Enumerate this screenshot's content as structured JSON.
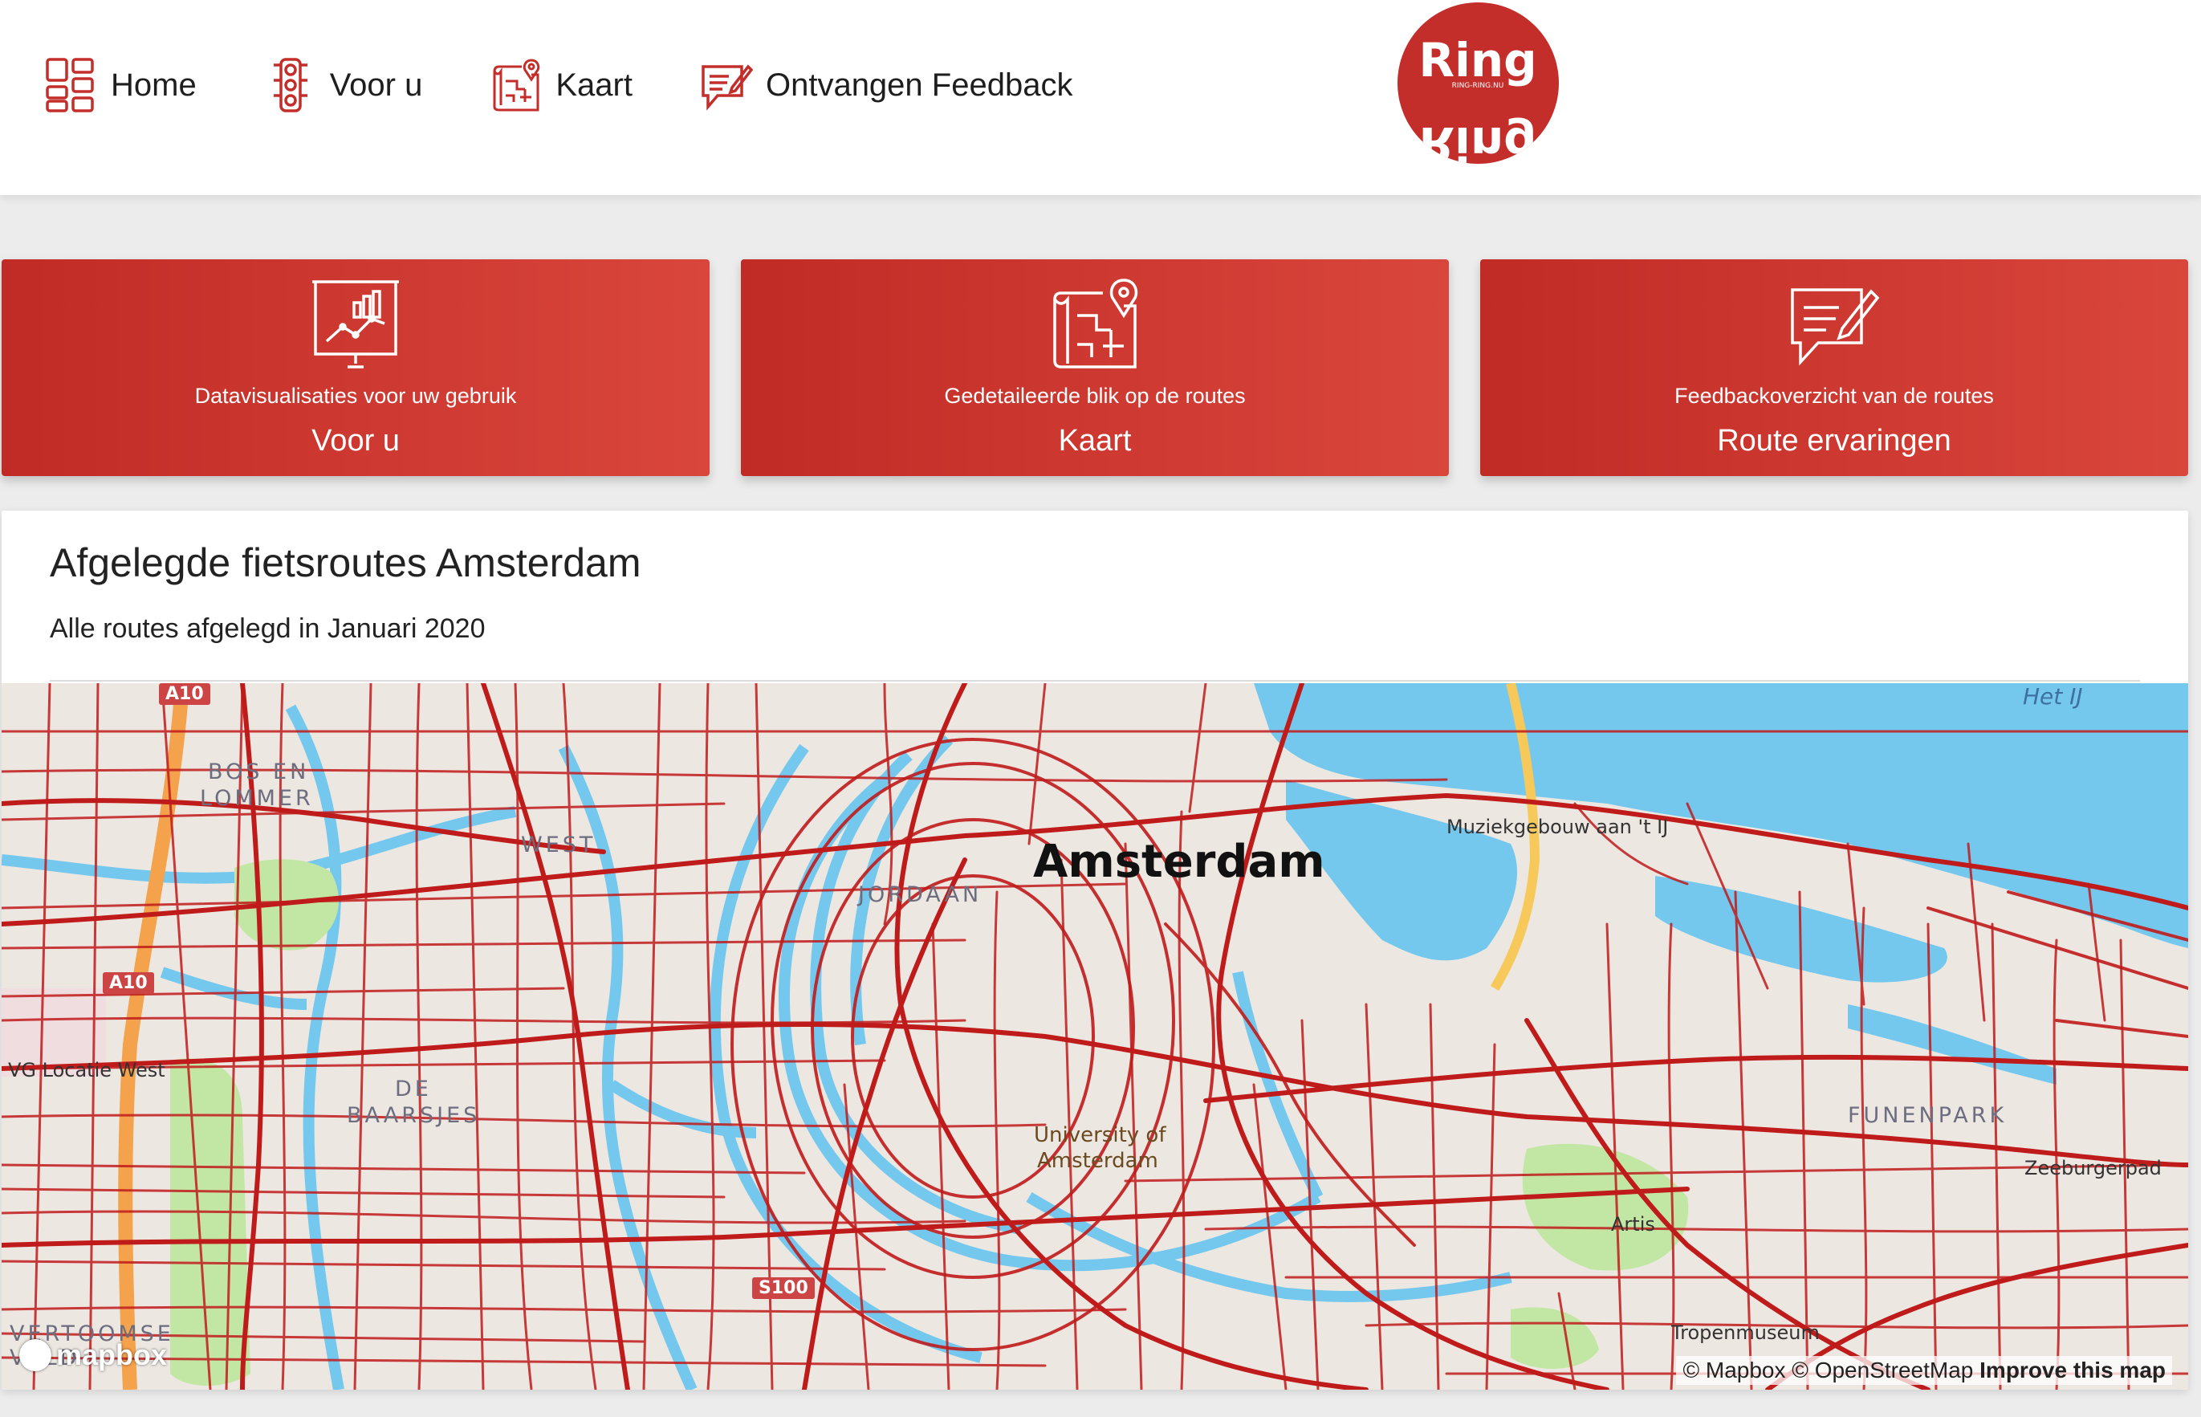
{
  "nav": {
    "items": [
      {
        "label": "Home",
        "icon": "grid-icon"
      },
      {
        "label": "Voor u",
        "icon": "traffic-light-icon"
      },
      {
        "label": "Kaart",
        "icon": "map-pin-icon"
      },
      {
        "label": "Ontvangen Feedback",
        "icon": "feedback-pen-icon"
      }
    ]
  },
  "logo": {
    "top": "Ring",
    "bottom": "Ring",
    "tagline": "RING-RING.NU"
  },
  "cards": [
    {
      "subtitle": "Datavisualisaties voor uw gebruik",
      "title": "Voor u",
      "icon": "presentation-chart-icon"
    },
    {
      "subtitle": "Gedetaileerde blik op de routes",
      "title": "Kaart",
      "icon": "map-pin-icon"
    },
    {
      "subtitle": "Feedbackoverzicht van de routes",
      "title": "Route ervaringen",
      "icon": "feedback-pen-icon"
    }
  ],
  "panel": {
    "title": "Afgelegde fietsroutes Amsterdam",
    "subtitle": "Alle routes afgelegd in Januari 2020"
  },
  "map": {
    "labels": {
      "city": "Amsterdam",
      "bos_en_lommer_1": "BOS EN",
      "bos_en_lommer_2": "LOMMER",
      "west": "WEST",
      "jordaan": "JORDAAN",
      "de_baarsjes_1": "DE",
      "de_baarsjes_2": "BAARSJES",
      "het_ij": "Het IJ",
      "muziekgebouw": "Muziekgebouw aan 't IJ",
      "locatie_west": "VG Locatie West",
      "university_1": "University of",
      "university_2": "Amsterdam",
      "artis": "Artis",
      "funenpark": "FUNENPARK",
      "zeeburgerpad": "Zeeburgerpad",
      "tropenmuseum": "Tropenmuseum",
      "slotervaart_1": "VERTOOMSE",
      "slotervaart_2": "VELD",
      "road_a10_top": "A10",
      "road_a10": "A10",
      "road_s100": "S100"
    },
    "logo": "mapbox",
    "attribution": {
      "mapbox": "© Mapbox",
      "osm": "© OpenStreetMap",
      "improve": "Improve this map"
    },
    "colors": {
      "land": "#ece7e1",
      "water": "#74c8ee",
      "park": "#c2e6a4",
      "route": "#c01b1b",
      "highway": "#f4a24b"
    }
  }
}
